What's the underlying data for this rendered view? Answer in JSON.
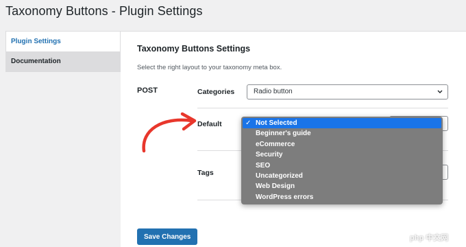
{
  "page": {
    "title": "Taxonomy Buttons - Plugin Settings"
  },
  "sidebar": {
    "items": [
      {
        "label": "Plugin Settings"
      },
      {
        "label": "Documentation"
      }
    ]
  },
  "settings": {
    "section_title": "Taxonomy Buttons Settings",
    "description": "Select the right layout to your taxonomy meta box.",
    "group_label": "POST",
    "rows": [
      {
        "label": "Categories",
        "value": "Radio button"
      },
      {
        "label": "Default",
        "value": "Not Selected"
      },
      {
        "label": "Tags",
        "value": ""
      }
    ]
  },
  "dropdown": {
    "check_icon": "✓",
    "options": [
      "Not Selected",
      "Beginner's guide",
      "eCommerce",
      "Security",
      "SEO",
      "Uncategorized",
      "Web Design",
      "WordPress errors"
    ]
  },
  "footer": {
    "save_label": "Save Changes"
  },
  "watermark": {
    "text": "php 中文网"
  },
  "colors": {
    "accent": "#2271b1",
    "dropdown_bg": "#7d7d7d",
    "dropdown_selected": "#1a74e8",
    "arrow": "#e8372c"
  }
}
